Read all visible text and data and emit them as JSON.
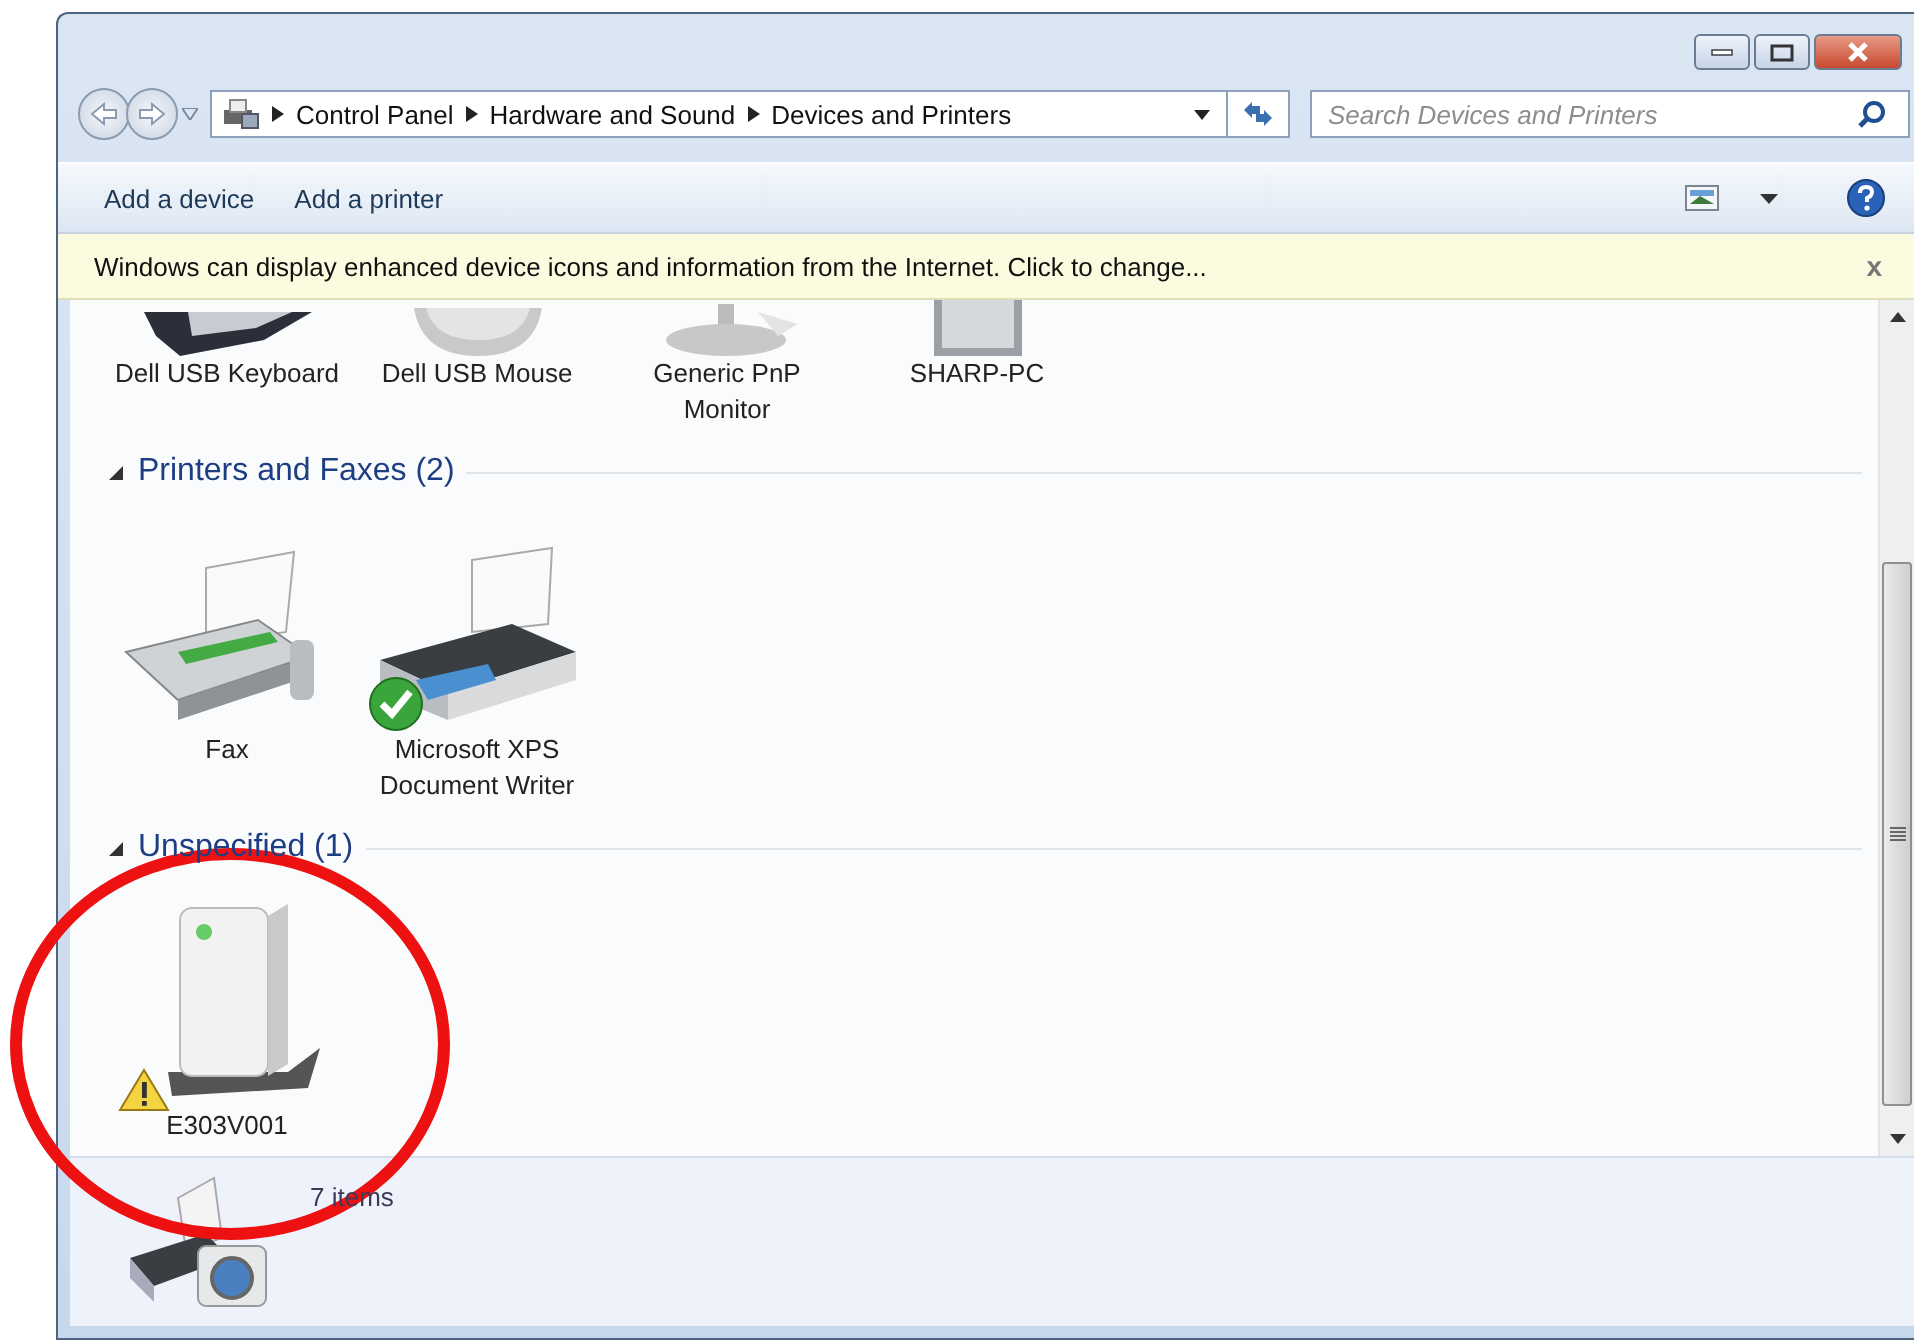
{
  "address_bar": {
    "breadcrumbs": [
      "Control Panel",
      "Hardware and Sound",
      "Devices and Printers"
    ]
  },
  "search": {
    "placeholder": "Search Devices and Printers"
  },
  "toolbar": {
    "buttons": [
      "Add a device",
      "Add a printer"
    ]
  },
  "info_bar": {
    "text": "Windows can display enhanced device icons and information from the Internet. Click to change...",
    "close": "x"
  },
  "groups": [
    {
      "items": [
        {
          "label": "Dell USB Keyboard",
          "kind": "keyboard"
        },
        {
          "label": "Dell USB Mouse",
          "kind": "mouse"
        },
        {
          "label": "Generic PnP Monitor",
          "kind": "monitor"
        },
        {
          "label": "SHARP-PC",
          "kind": "computer"
        }
      ]
    },
    {
      "header": "Printers and Faxes (2)",
      "expanded": true,
      "items": [
        {
          "label": "Fax",
          "kind": "fax"
        },
        {
          "label": "Microsoft XPS Document Writer",
          "kind": "printer",
          "default_printer": true
        }
      ]
    },
    {
      "header": "Unspecified (1)",
      "expanded": true,
      "items": [
        {
          "label": "E303V001",
          "kind": "storage",
          "warning": true
        }
      ]
    }
  ],
  "details": {
    "text": "7 items"
  }
}
